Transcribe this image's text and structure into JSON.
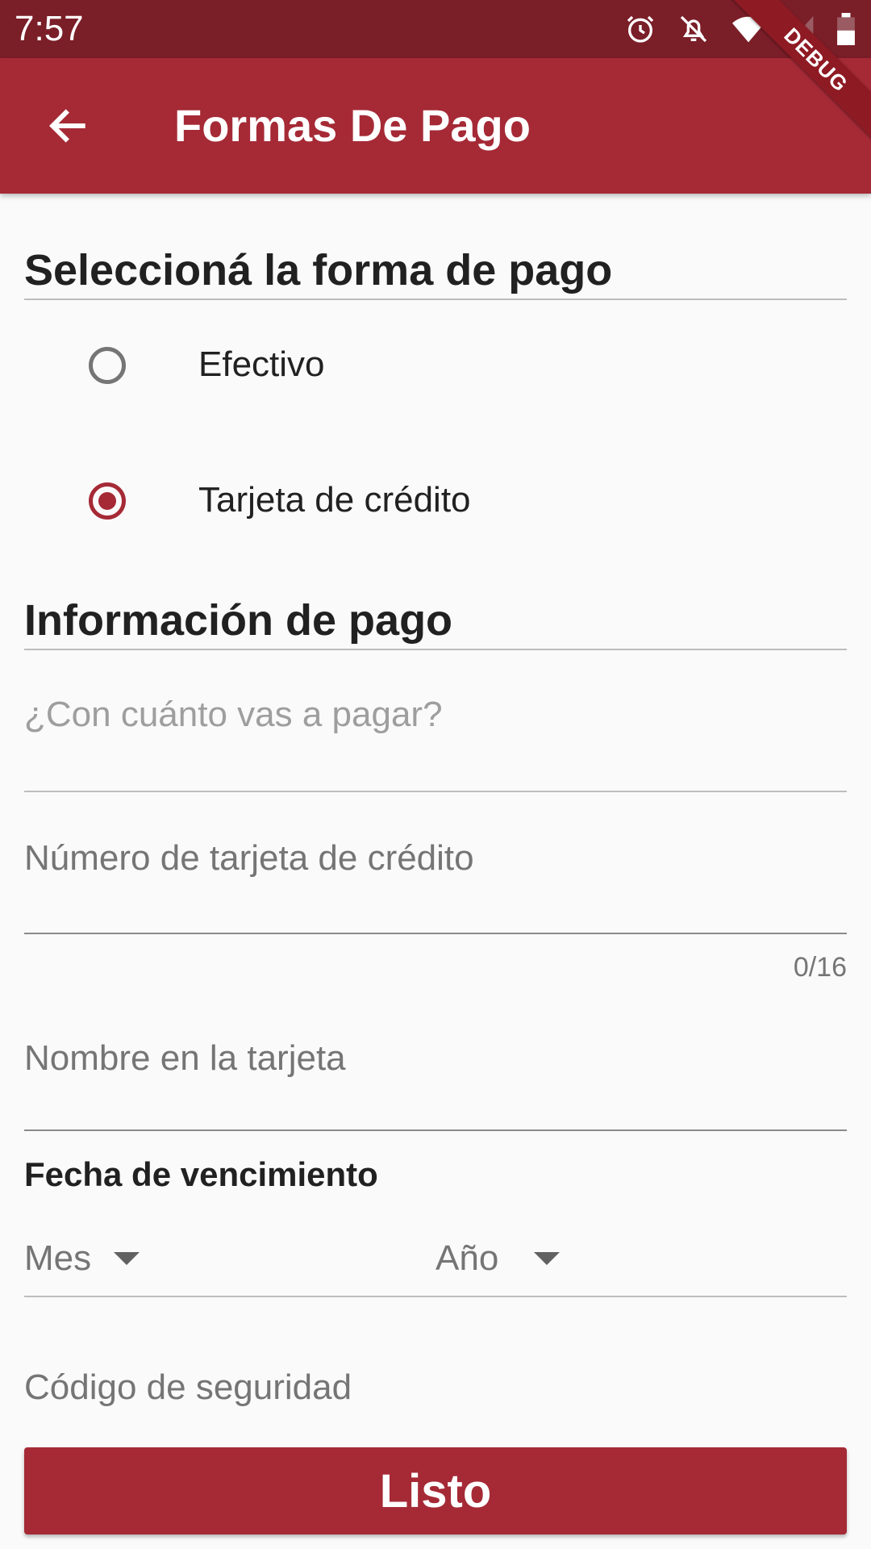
{
  "status_bar": {
    "time": "7:57",
    "icons": [
      "alarm-icon",
      "notifications-off-icon",
      "wifi-icon",
      "signal-icon",
      "battery-icon"
    ]
  },
  "debug_banner": "DEBUG",
  "app_bar": {
    "back_icon": "arrow-back-icon",
    "title": "Formas De Pago"
  },
  "payment_method": {
    "heading": "Seleccioná la forma de pago",
    "options": [
      {
        "label": "Efectivo",
        "selected": false
      },
      {
        "label": "Tarjeta de crédito",
        "selected": true
      }
    ]
  },
  "payment_info": {
    "heading": "Información de pago",
    "amount_hint": "¿Con cuánto vas a pagar?",
    "card_number_label": "Número de tarjeta de crédito",
    "card_number_counter": "0/16",
    "card_name_label": "Nombre en la tarjeta",
    "expiration": {
      "heading": "Fecha de vencimiento",
      "month_label": "Mes",
      "year_label": "Año"
    },
    "security_code_label": "Código de seguridad"
  },
  "submit_button": "Listo",
  "colors": {
    "primary": "#a52a36",
    "status_bar": "#7a1e28",
    "background": "#fafafa"
  }
}
